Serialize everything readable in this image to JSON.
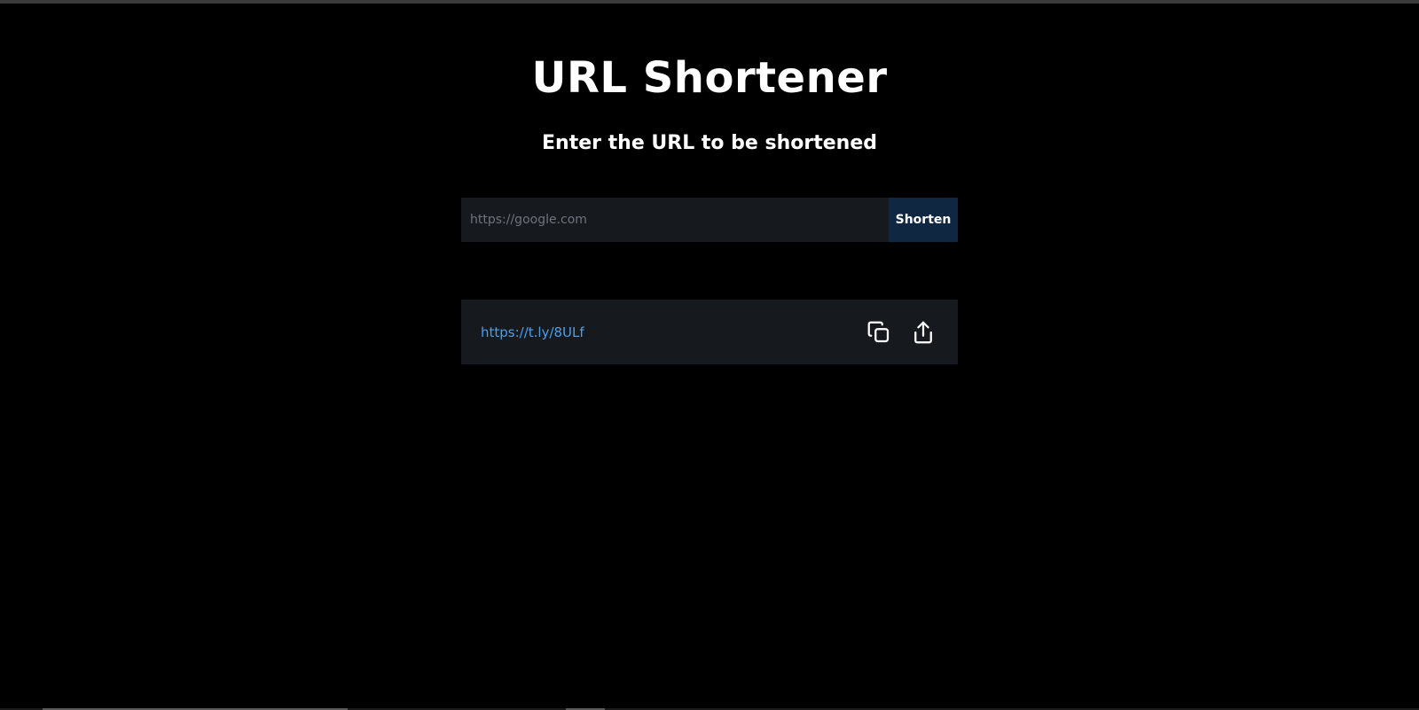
{
  "header": {
    "title": "URL Shortener",
    "subtitle": "Enter the URL to be shortened"
  },
  "form": {
    "input_value": "",
    "input_placeholder": "https://google.com",
    "button_label": "Shorten"
  },
  "result": {
    "short_url": "https://t.ly/8ULf",
    "copy_icon": "copy-icon",
    "share_icon": "share-icon"
  },
  "colors": {
    "background": "#000000",
    "panel": "#16191e",
    "button": "#0f2740",
    "link": "#4d9fe8",
    "text": "#ffffff"
  }
}
